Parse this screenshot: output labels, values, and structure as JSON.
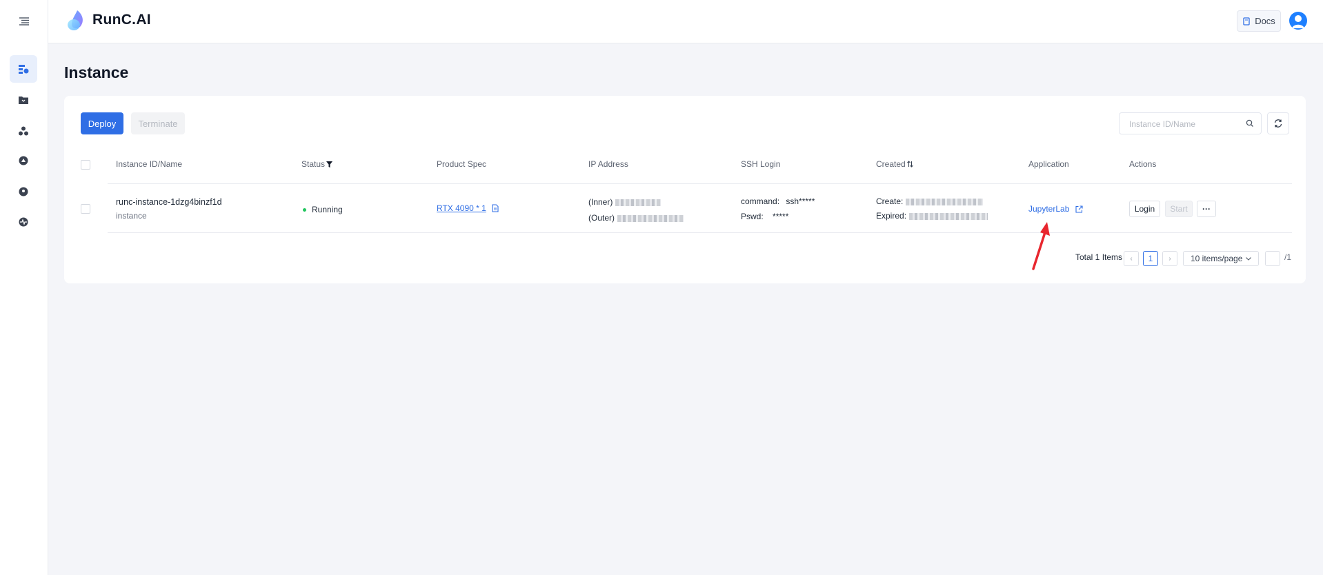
{
  "app": {
    "brand": "RunC.AI"
  },
  "header": {
    "docs_label": "Docs"
  },
  "sidebar": {
    "items": [
      {
        "icon": "instance-icon",
        "active": true
      },
      {
        "icon": "folder-icon",
        "active": false
      },
      {
        "icon": "cluster-icon",
        "active": false
      },
      {
        "icon": "storage-icon",
        "active": false
      },
      {
        "icon": "location-icon",
        "active": false
      },
      {
        "icon": "monitor-icon",
        "active": false
      }
    ]
  },
  "page": {
    "title": "Instance"
  },
  "toolbar": {
    "deploy_label": "Deploy",
    "terminate_label": "Terminate",
    "search_placeholder": "Instance ID/Name"
  },
  "table": {
    "headers": {
      "name": "Instance ID/Name",
      "status": "Status",
      "spec": "Product Spec",
      "ip": "IP Address",
      "ssh": "SSH Login",
      "created": "Created",
      "application": "Application",
      "actions": "Actions"
    },
    "rows": [
      {
        "id": "runc-instance-1dzg4binzf1d",
        "name": "instance",
        "status": "Running",
        "spec": "RTX 4090 * 1",
        "ip_inner_label": "(Inner)",
        "ip_outer_label": "(Outer)",
        "ssh_command_label": "command:",
        "ssh_command_value": "ssh*****",
        "ssh_pswd_label": "Pswd:",
        "ssh_pswd_value": "*****",
        "create_label": "Create:",
        "expired_label": "Expired:",
        "application": "JupyterLab",
        "login_label": "Login",
        "start_label": "Start",
        "more_label": "···"
      }
    ]
  },
  "pagination": {
    "total_label": "Total 1 Items",
    "current_page": "1",
    "page_size_label": "10 items/page",
    "total_pages_label": "/1"
  },
  "colors": {
    "primary": "#2f6ee5",
    "running": "#22c55e",
    "annotation_arrow": "#e8262e"
  }
}
